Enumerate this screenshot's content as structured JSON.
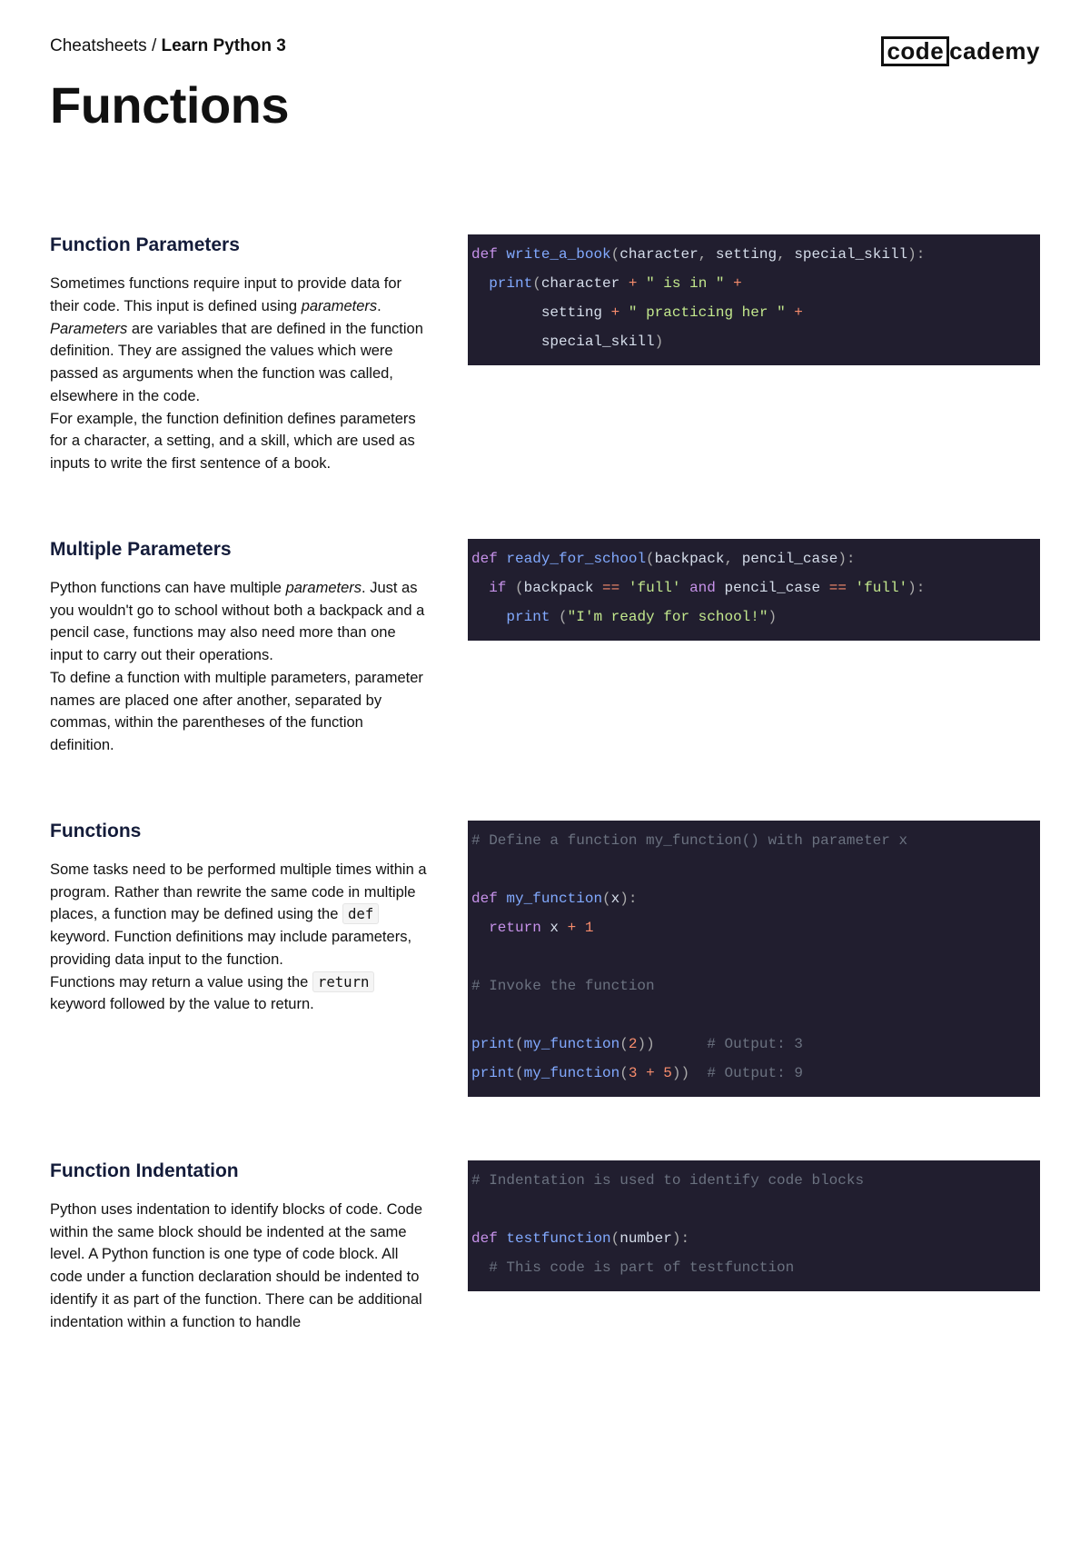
{
  "breadcrumb": {
    "root": "Cheatsheets",
    "sep": "/",
    "course": "Learn Python 3"
  },
  "logo": {
    "boxed": "code",
    "rest": "cademy"
  },
  "title": "Functions",
  "sections": [
    {
      "heading": "Function Parameters",
      "body": "Sometimes functions require input to provide data for their code. This input is defined using <em>parameters</em>.<br><em>Parameters</em> are variables that are defined in the function definition. They are assigned the values which were passed as arguments when the function was called, elsewhere in the code.<br>For example, the function definition defines parameters for a character, a setting, and a skill, which are used as inputs to write the first sentence of a book.",
      "code": "<span class=\"kw\">def</span> <span class=\"fn\">write_a_book</span><span class=\"p\">(</span><span class=\"id\">character</span><span class=\"p\">,</span> <span class=\"id\">setting</span><span class=\"p\">,</span> <span class=\"id\">special_skill</span><span class=\"p\">):</span>\n  <span class=\"pr\">print</span><span class=\"p\">(</span><span class=\"id\">character</span> <span class=\"op\">+</span> <span class=\"str\">\" is in \"</span> <span class=\"op\">+</span>\n        <span class=\"id\">setting</span> <span class=\"op\">+</span> <span class=\"str\">\" practicing her \"</span> <span class=\"op\">+</span>\n        <span class=\"id\">special_skill</span><span class=\"p\">)</span>"
    },
    {
      "heading": "Multiple Parameters",
      "body": "Python functions can have multiple <em>parameters</em>. Just as you wouldn't go to school without both a backpack and a pencil case, functions may also need more than one input to carry out their operations.<br>To define a function with multiple parameters, parameter names are placed one after another, separated by commas, within the parentheses of the function definition.",
      "code": "<span class=\"kw\">def</span> <span class=\"fn\">ready_for_school</span><span class=\"p\">(</span><span class=\"id\">backpack</span><span class=\"p\">,</span> <span class=\"id\">pencil_case</span><span class=\"p\">):</span>\n  <span class=\"kw\">if</span> <span class=\"p\">(</span><span class=\"id\">backpack</span> <span class=\"op\">==</span> <span class=\"str\">'full'</span> <span class=\"kw\">and</span> <span class=\"id\">pencil_case</span> <span class=\"op\">==</span> <span class=\"str\">'full'</span><span class=\"p\">):</span>\n    <span class=\"pr\">print</span> <span class=\"p\">(</span><span class=\"str\">\"I'm ready for school!\"</span><span class=\"p\">)</span>"
    },
    {
      "heading": "Functions",
      "body": "Some tasks need to be performed multiple times within a program. Rather than rewrite the same code in multiple places, a function may be defined using the <code class=\"inline\">def</code> keyword. Function definitions may include parameters, providing data input to the function.<br>Functions may return a value using the <code class=\"inline\">return</code> keyword followed by the value to return.",
      "code": "<span class=\"cmt\"># Define a function my_function() with parameter x</span>\n\n<span class=\"kw\">def</span> <span class=\"fn\">my_function</span><span class=\"p\">(</span><span class=\"id\">x</span><span class=\"p\">):</span>\n  <span class=\"kw\">return</span> <span class=\"id\">x</span> <span class=\"op\">+</span> <span class=\"num\">1</span>\n\n<span class=\"cmt\"># Invoke the function</span>\n\n<span class=\"pr\">print</span><span class=\"p\">(</span><span class=\"fn\">my_function</span><span class=\"p\">(</span><span class=\"num\">2</span><span class=\"p\">))</span>      <span class=\"cmt\"># Output: 3</span>\n<span class=\"pr\">print</span><span class=\"p\">(</span><span class=\"fn\">my_function</span><span class=\"p\">(</span><span class=\"num\">3</span> <span class=\"op\">+</span> <span class=\"num\">5</span><span class=\"p\">))</span>  <span class=\"cmt\"># Output: 9</span>"
    },
    {
      "heading": "Function Indentation",
      "body": "Python uses indentation to identify blocks of code. Code within the same block should be indented at the same level. A Python function is one type of code block. All code under a function declaration should be indented to identify it as part of the function. There can be additional indentation within a function to handle",
      "code": "<span class=\"cmt\"># Indentation is used to identify code blocks</span>\n\n<span class=\"kw\">def</span> <span class=\"fn\">testfunction</span><span class=\"p\">(</span><span class=\"id\">number</span><span class=\"p\">):</span>\n  <span class=\"cmt\"># This code is part of testfunction</span>"
    }
  ]
}
